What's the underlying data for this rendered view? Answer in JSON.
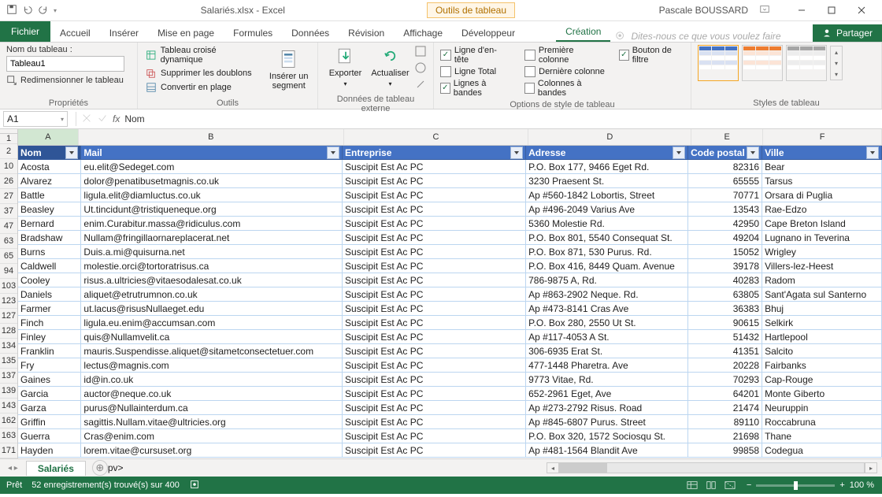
{
  "title": "Salariés.xlsx - Excel",
  "tableTools": {
    "label": "Outils de tableau"
  },
  "user": "Pascale BOUSSARD",
  "fileTab": "Fichier",
  "tabs": [
    "Accueil",
    "Insérer",
    "Mise en page",
    "Formules",
    "Données",
    "Révision",
    "Affichage",
    "Développeur"
  ],
  "contextTab": "Création",
  "tellMe": "Dites-nous ce que vous voulez faire",
  "share": "Partager",
  "props": {
    "label": "Nom du tableau :",
    "name": "Tableau1",
    "resize": "Redimensionner le tableau",
    "group": "Propriétés"
  },
  "tools": {
    "pivot": "Tableau croisé dynamique",
    "dedup": "Supprimer les doublons",
    "range": "Convertir en plage",
    "slicer": "Insérer un segment",
    "group": "Outils"
  },
  "ext": {
    "export": "Exporter",
    "refresh": "Actualiser",
    "group": "Données de tableau externe"
  },
  "styleOpts": {
    "headerRow": "Ligne d'en-tête",
    "totalRow": "Ligne Total",
    "banded": "Lignes à bandes",
    "firstCol": "Première colonne",
    "lastCol": "Dernière colonne",
    "bandedCols": "Colonnes à bandes",
    "filterBtn": "Bouton de filtre",
    "group": "Options de style de tableau"
  },
  "stylesGroup": "Styles de tableau",
  "nameBox": "A1",
  "formula": "Nom",
  "cols": [
    "A",
    "B",
    "C",
    "D",
    "E",
    "F"
  ],
  "headers": [
    "Nom",
    "Mail",
    "Entreprise",
    "Adresse",
    "Code postal",
    "Ville"
  ],
  "rows": [
    {
      "n": 2,
      "d": [
        "Acosta",
        "eu.elit@Sedeget.com",
        "Suscipit Est Ac PC",
        "P.O. Box 177, 9466 Eget Rd.",
        "82316",
        "Bear"
      ]
    },
    {
      "n": 10,
      "d": [
        "Alvarez",
        "dolor@penatibusetmagnis.co.uk",
        "Suscipit Est Ac PC",
        "3230 Praesent St.",
        "65555",
        "Tarsus"
      ]
    },
    {
      "n": 26,
      "d": [
        "Battle",
        "ligula.elit@diamluctus.co.uk",
        "Suscipit Est Ac PC",
        "Ap #560-1842 Lobortis, Street",
        "70771",
        "Orsara di Puglia"
      ]
    },
    {
      "n": 27,
      "d": [
        "Beasley",
        "Ut.tincidunt@tristiqueneque.org",
        "Suscipit Est Ac PC",
        "Ap #496-2049 Varius Ave",
        "13543",
        "Rae-Edzo"
      ]
    },
    {
      "n": 37,
      "d": [
        "Bernard",
        "enim.Curabitur.massa@ridiculus.com",
        "Suscipit Est Ac PC",
        "5360 Molestie Rd.",
        "42950",
        "Cape Breton Island"
      ]
    },
    {
      "n": 47,
      "d": [
        "Bradshaw",
        "Nullam@fringillaornareplacerat.net",
        "Suscipit Est Ac PC",
        "P.O. Box 801, 5540 Consequat St.",
        "49204",
        "Lugnano in Teverina"
      ]
    },
    {
      "n": 63,
      "d": [
        "Burns",
        "Duis.a.mi@quisurna.net",
        "Suscipit Est Ac PC",
        "P.O. Box 871, 530 Purus. Rd.",
        "15052",
        "Wrigley"
      ]
    },
    {
      "n": 65,
      "d": [
        "Caldwell",
        "molestie.orci@tortoratrisus.ca",
        "Suscipit Est Ac PC",
        "P.O. Box 416, 8449 Quam. Avenue",
        "39178",
        "Villers-lez-Heest"
      ]
    },
    {
      "n": 94,
      "d": [
        "Cooley",
        "risus.a.ultricies@vitaesodalesat.co.uk",
        "Suscipit Est Ac PC",
        "786-9875 A, Rd.",
        "40283",
        "Radom"
      ]
    },
    {
      "n": 103,
      "d": [
        "Daniels",
        "aliquet@etrutrumnon.co.uk",
        "Suscipit Est Ac PC",
        "Ap #863-2902 Neque. Rd.",
        "63805",
        "Sant'Agata sul Santerno"
      ]
    },
    {
      "n": 123,
      "d": [
        "Farmer",
        "ut.lacus@risusNullaeget.edu",
        "Suscipit Est Ac PC",
        "Ap #473-8141 Cras Ave",
        "36383",
        "Bhuj"
      ]
    },
    {
      "n": 127,
      "d": [
        "Finch",
        "ligula.eu.enim@accumsan.com",
        "Suscipit Est Ac PC",
        "P.O. Box 280, 2550 Ut St.",
        "90615",
        "Selkirk"
      ]
    },
    {
      "n": 128,
      "d": [
        "Finley",
        "quis@Nullamvelit.ca",
        "Suscipit Est Ac PC",
        "Ap #117-4053 A St.",
        "51432",
        "Hartlepool"
      ]
    },
    {
      "n": 134,
      "d": [
        "Franklin",
        "mauris.Suspendisse.aliquet@sitametconsectetuer.com",
        "Suscipit Est Ac PC",
        "306-6935 Erat St.",
        "41351",
        "Salcito"
      ]
    },
    {
      "n": 135,
      "d": [
        "Fry",
        "lectus@magnis.com",
        "Suscipit Est Ac PC",
        "477-1448 Pharetra. Ave",
        "20228",
        "Fairbanks"
      ]
    },
    {
      "n": 137,
      "d": [
        "Gaines",
        "id@in.co.uk",
        "Suscipit Est Ac PC",
        "9773 Vitae, Rd.",
        "70293",
        "Cap-Rouge"
      ]
    },
    {
      "n": 139,
      "d": [
        "Garcia",
        "auctor@neque.co.uk",
        "Suscipit Est Ac PC",
        "652-2961 Eget, Ave",
        "64201",
        "Monte Giberto"
      ]
    },
    {
      "n": 143,
      "d": [
        "Garza",
        "purus@Nullainterdum.ca",
        "Suscipit Est Ac PC",
        "Ap #273-2792 Risus. Road",
        "21474",
        "Neuruppin"
      ]
    },
    {
      "n": 162,
      "d": [
        "Griffin",
        "sagittis.Nullam.vitae@ultricies.org",
        "Suscipit Est Ac PC",
        "Ap #845-6807 Purus. Street",
        "89110",
        "Roccabruna"
      ]
    },
    {
      "n": 163,
      "d": [
        "Guerra",
        "Cras@enim.com",
        "Suscipit Est Ac PC",
        "P.O. Box 320, 1572 Sociosqu St.",
        "21698",
        "Thane"
      ]
    },
    {
      "n": 171,
      "d": [
        "Hayden",
        "lorem.vitae@cursuset.org",
        "Suscipit Est Ac PC",
        "Ap #481-1564 Blandit Ave",
        "99858",
        "Codegua"
      ]
    }
  ],
  "sheetTab": "Salariés",
  "status": {
    "ready": "Prêt",
    "found": "52 enregistrement(s) trouvé(s) sur 400",
    "zoom": "100 %"
  }
}
